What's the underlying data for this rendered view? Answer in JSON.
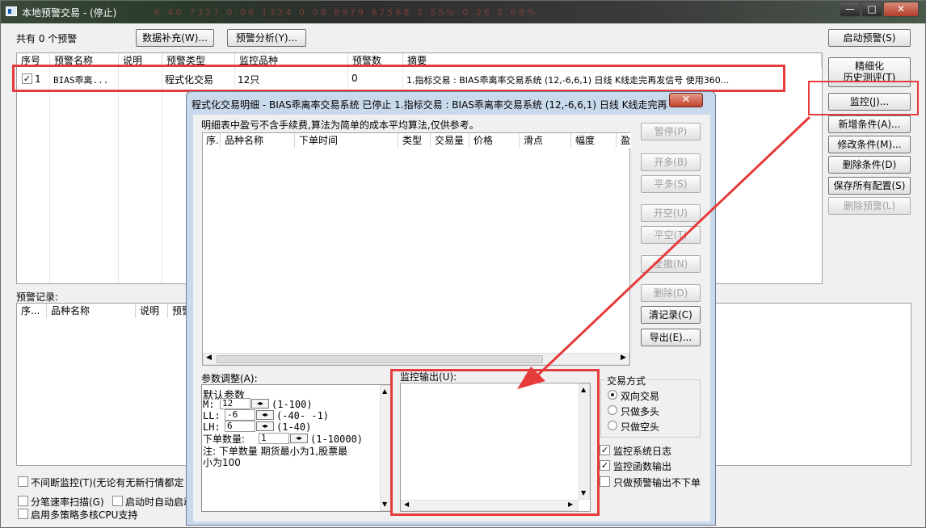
{
  "window": {
    "title": "本地预警交易 - (停止)",
    "title_ticker": "6.40  7327  0.06  1324  0.08  8979  67568  2.55%  0.26  2.68%",
    "minimize": "—",
    "maximize": "□",
    "close": "✕"
  },
  "main": {
    "count_label": "共有 0 个预警",
    "data_fill_button": "数据补充(W)...",
    "analysis_button": "预警分析(Y)...",
    "start_button": "启动预警(S)",
    "table": {
      "headers": [
        "序号",
        "预警名称",
        "说明",
        "预警类型",
        "监控品种",
        "预警数",
        "摘要"
      ],
      "row": {
        "checked": true,
        "index": "1",
        "name": "BIAS乖离...",
        "desc": "",
        "type": "程式化交易",
        "variety": "12只",
        "count": "0",
        "summary": "1.指标交易 : BIAS乖离率交易系统 (12,-6,6,1) 日线 K线走完再发信号 使用360..."
      }
    },
    "side_buttons": {
      "refine": "精细化\n历史测评(T)",
      "refine_line1": "精细化",
      "refine_line2": "历史测评(T)",
      "monitor": "监控(J)...",
      "add_condition": "新增条件(A)...",
      "modify_condition": "修改条件(M)...",
      "delete_condition": "删除条件(D)",
      "save_all": "保存所有配置(S)",
      "delete_alert": "删除预警(L)"
    },
    "records_label": "预警记录:",
    "records_headers": [
      "序...",
      "品种名称",
      "说明",
      "预警"
    ],
    "options": {
      "continuous_monitor": "不间断监控(T)(无论有无新行情都定",
      "tick_scan": "分笔速率扫描(G)",
      "auto_start": "启动时自动启动",
      "multi_core": "启用多策略多核CPU支持"
    }
  },
  "dialog": {
    "title": "程式化交易明细 - BIAS乖离率交易系统 已停止  1.指标交易 : BIAS乖离率交易系统 (12,-6,6,1) 日线 K线走完再...",
    "close": "✕",
    "note": "明细表中盈亏不含手续费,算法为简单的成本平均算法,仅供参考。",
    "table_headers": [
      "序.",
      "品种名称",
      "下单时间",
      "类型",
      "交易量",
      "价格",
      "滑点",
      "幅度",
      "盈"
    ],
    "buttons": {
      "pause": "暂停(P)",
      "open_long": "开多(B)",
      "close_long": "平多(S)",
      "open_short": "开空(U)",
      "close_short": "平空(T)",
      "cancel_all": "全撤(N)",
      "delete": "删除(D)",
      "clear_records": "清记录(C)",
      "export": "导出(E)..."
    },
    "params_label": "参数调整(A):",
    "params": {
      "default": "默认参数",
      "m_label": "M:",
      "m_value": "12",
      "m_range": "(1-100)",
      "ll_label": "LL:",
      "ll_value": "-6",
      "ll_range": "(-40- -1)",
      "lh_label": "LH:",
      "lh_value": "6",
      "lh_range": "(1-40)",
      "qty_label": "下单数量:",
      "qty_value": "1",
      "qty_range": "(1-10000)",
      "note_line1": "注: 下单数量 期货最小为1,股票最",
      "note_line2": "小为100"
    },
    "monitor_output_label": "监控输出(U):",
    "trade_mode": {
      "label": "交易方式",
      "options": [
        "双向交易",
        "只做多头",
        "只做空头"
      ],
      "selected": 0
    },
    "checks": {
      "system_log": "监控系统日志",
      "function_output": "监控函数输出",
      "alert_only": "只做预警输出不下单"
    }
  },
  "colors": {
    "highlight": "#e63b3b",
    "dialog_frame": "#c9d9ec"
  }
}
